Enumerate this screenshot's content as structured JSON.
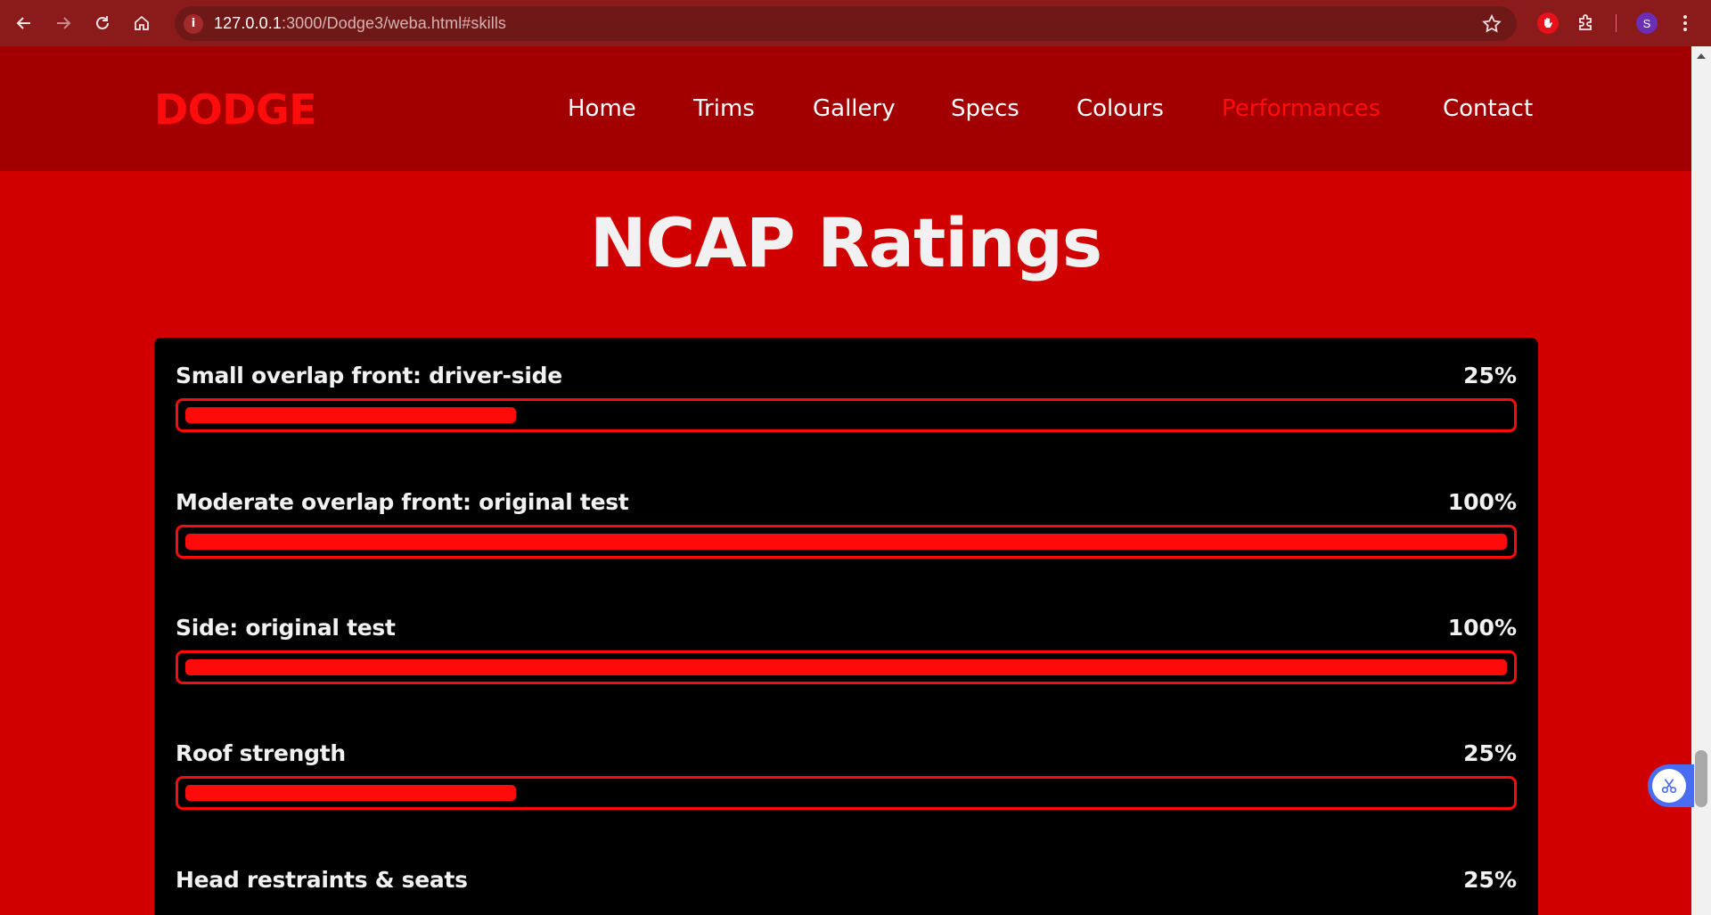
{
  "browser": {
    "url_host": "127.0.0.1",
    "url_rest": ":3000/Dodge3/weba.html#skills",
    "profile_initial": "S"
  },
  "site": {
    "logo": "DODGE",
    "nav": [
      {
        "label": "Home",
        "active": false
      },
      {
        "label": "Trims",
        "active": false
      },
      {
        "label": "Gallery",
        "active": false
      },
      {
        "label": "Specs",
        "active": false
      },
      {
        "label": "Colours",
        "active": false
      },
      {
        "label": "Performances",
        "active": true
      },
      {
        "label": "Contact",
        "active": false
      }
    ]
  },
  "section": {
    "title": "NCAP Ratings",
    "ratings": [
      {
        "label": "Small overlap front: driver-side",
        "percent_text": "25%",
        "value": 25
      },
      {
        "label": "Moderate overlap front: original test",
        "percent_text": "100%",
        "value": 100
      },
      {
        "label": "Side: original test",
        "percent_text": "100%",
        "value": 100
      },
      {
        "label": "Roof strength",
        "percent_text": "25%",
        "value": 25
      },
      {
        "label": "Head restraints & seats",
        "percent_text": "25%",
        "value": 25
      }
    ]
  },
  "colors": {
    "page_bg": "#d10000",
    "header_bg": "#a20000",
    "accent": "#ff0a0a",
    "card_bg": "#000000",
    "chrome_bg": "#8b1a1a"
  },
  "icons": {
    "back": "back-arrow-icon",
    "forward": "forward-arrow-icon",
    "reload": "reload-icon",
    "home": "home-icon",
    "site_info": "info-icon",
    "bookmark": "star-icon",
    "extension_hand": "hand-icon",
    "extensions": "puzzle-icon",
    "menu": "kebab-menu-icon",
    "floating": "scissors-icon"
  }
}
